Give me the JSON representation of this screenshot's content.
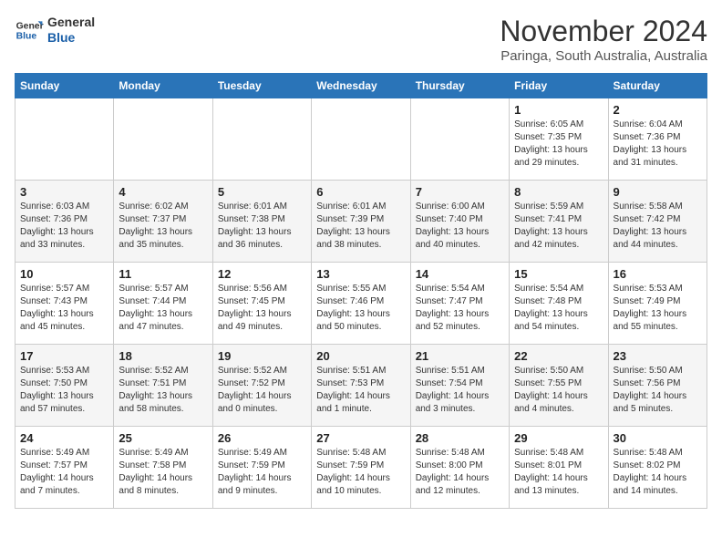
{
  "logo": {
    "line1": "General",
    "line2": "Blue"
  },
  "header": {
    "month": "November 2024",
    "location": "Paringa, South Australia, Australia"
  },
  "weekdays": [
    "Sunday",
    "Monday",
    "Tuesday",
    "Wednesday",
    "Thursday",
    "Friday",
    "Saturday"
  ],
  "weeks": [
    [
      {
        "day": "",
        "info": ""
      },
      {
        "day": "",
        "info": ""
      },
      {
        "day": "",
        "info": ""
      },
      {
        "day": "",
        "info": ""
      },
      {
        "day": "",
        "info": ""
      },
      {
        "day": "1",
        "info": "Sunrise: 6:05 AM\nSunset: 7:35 PM\nDaylight: 13 hours\nand 29 minutes."
      },
      {
        "day": "2",
        "info": "Sunrise: 6:04 AM\nSunset: 7:36 PM\nDaylight: 13 hours\nand 31 minutes."
      }
    ],
    [
      {
        "day": "3",
        "info": "Sunrise: 6:03 AM\nSunset: 7:36 PM\nDaylight: 13 hours\nand 33 minutes."
      },
      {
        "day": "4",
        "info": "Sunrise: 6:02 AM\nSunset: 7:37 PM\nDaylight: 13 hours\nand 35 minutes."
      },
      {
        "day": "5",
        "info": "Sunrise: 6:01 AM\nSunset: 7:38 PM\nDaylight: 13 hours\nand 36 minutes."
      },
      {
        "day": "6",
        "info": "Sunrise: 6:01 AM\nSunset: 7:39 PM\nDaylight: 13 hours\nand 38 minutes."
      },
      {
        "day": "7",
        "info": "Sunrise: 6:00 AM\nSunset: 7:40 PM\nDaylight: 13 hours\nand 40 minutes."
      },
      {
        "day": "8",
        "info": "Sunrise: 5:59 AM\nSunset: 7:41 PM\nDaylight: 13 hours\nand 42 minutes."
      },
      {
        "day": "9",
        "info": "Sunrise: 5:58 AM\nSunset: 7:42 PM\nDaylight: 13 hours\nand 44 minutes."
      }
    ],
    [
      {
        "day": "10",
        "info": "Sunrise: 5:57 AM\nSunset: 7:43 PM\nDaylight: 13 hours\nand 45 minutes."
      },
      {
        "day": "11",
        "info": "Sunrise: 5:57 AM\nSunset: 7:44 PM\nDaylight: 13 hours\nand 47 minutes."
      },
      {
        "day": "12",
        "info": "Sunrise: 5:56 AM\nSunset: 7:45 PM\nDaylight: 13 hours\nand 49 minutes."
      },
      {
        "day": "13",
        "info": "Sunrise: 5:55 AM\nSunset: 7:46 PM\nDaylight: 13 hours\nand 50 minutes."
      },
      {
        "day": "14",
        "info": "Sunrise: 5:54 AM\nSunset: 7:47 PM\nDaylight: 13 hours\nand 52 minutes."
      },
      {
        "day": "15",
        "info": "Sunrise: 5:54 AM\nSunset: 7:48 PM\nDaylight: 13 hours\nand 54 minutes."
      },
      {
        "day": "16",
        "info": "Sunrise: 5:53 AM\nSunset: 7:49 PM\nDaylight: 13 hours\nand 55 minutes."
      }
    ],
    [
      {
        "day": "17",
        "info": "Sunrise: 5:53 AM\nSunset: 7:50 PM\nDaylight: 13 hours\nand 57 minutes."
      },
      {
        "day": "18",
        "info": "Sunrise: 5:52 AM\nSunset: 7:51 PM\nDaylight: 13 hours\nand 58 minutes."
      },
      {
        "day": "19",
        "info": "Sunrise: 5:52 AM\nSunset: 7:52 PM\nDaylight: 14 hours\nand 0 minutes."
      },
      {
        "day": "20",
        "info": "Sunrise: 5:51 AM\nSunset: 7:53 PM\nDaylight: 14 hours\nand 1 minute."
      },
      {
        "day": "21",
        "info": "Sunrise: 5:51 AM\nSunset: 7:54 PM\nDaylight: 14 hours\nand 3 minutes."
      },
      {
        "day": "22",
        "info": "Sunrise: 5:50 AM\nSunset: 7:55 PM\nDaylight: 14 hours\nand 4 minutes."
      },
      {
        "day": "23",
        "info": "Sunrise: 5:50 AM\nSunset: 7:56 PM\nDaylight: 14 hours\nand 5 minutes."
      }
    ],
    [
      {
        "day": "24",
        "info": "Sunrise: 5:49 AM\nSunset: 7:57 PM\nDaylight: 14 hours\nand 7 minutes."
      },
      {
        "day": "25",
        "info": "Sunrise: 5:49 AM\nSunset: 7:58 PM\nDaylight: 14 hours\nand 8 minutes."
      },
      {
        "day": "26",
        "info": "Sunrise: 5:49 AM\nSunset: 7:59 PM\nDaylight: 14 hours\nand 9 minutes."
      },
      {
        "day": "27",
        "info": "Sunrise: 5:48 AM\nSunset: 7:59 PM\nDaylight: 14 hours\nand 10 minutes."
      },
      {
        "day": "28",
        "info": "Sunrise: 5:48 AM\nSunset: 8:00 PM\nDaylight: 14 hours\nand 12 minutes."
      },
      {
        "day": "29",
        "info": "Sunrise: 5:48 AM\nSunset: 8:01 PM\nDaylight: 14 hours\nand 13 minutes."
      },
      {
        "day": "30",
        "info": "Sunrise: 5:48 AM\nSunset: 8:02 PM\nDaylight: 14 hours\nand 14 minutes."
      }
    ]
  ]
}
